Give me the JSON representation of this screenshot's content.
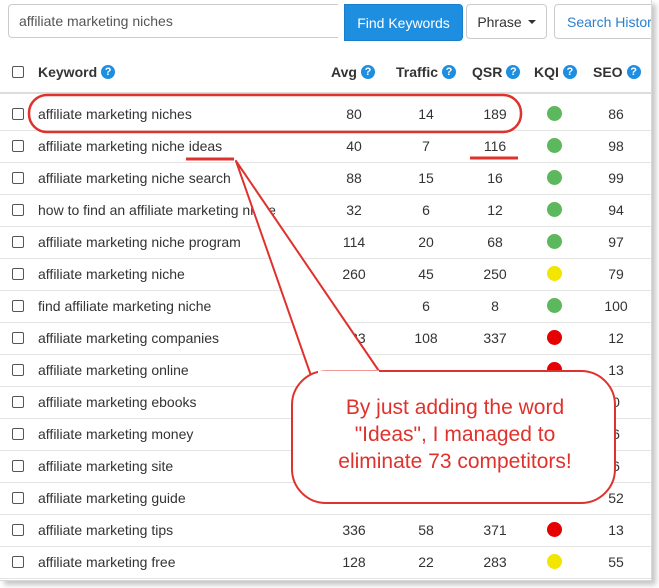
{
  "search": {
    "value": "affiliate marketing niches",
    "find_label": "Find Keywords",
    "phrase_label": "Phrase",
    "history_label": "Search History"
  },
  "headers": {
    "keyword": "Keyword",
    "avg": "Avg",
    "traffic": "Traffic",
    "qsr": "QSR",
    "kqi": "KQI",
    "seo": "SEO"
  },
  "colors": {
    "accent": "#1e8ee0",
    "annotation": "#e0322c",
    "kqi_green": "#5cb85c",
    "kqi_yellow": "#f2e600",
    "kqi_red": "#e60000"
  },
  "rows": [
    {
      "keyword": "affiliate marketing niches",
      "avg": "80",
      "traffic": "14",
      "qsr": "189",
      "kqi": "green",
      "seo": "86"
    },
    {
      "keyword": "affiliate marketing niche ideas",
      "avg": "40",
      "traffic": "7",
      "qsr": "116",
      "kqi": "green",
      "seo": "98"
    },
    {
      "keyword": "affiliate marketing niche search",
      "avg": "88",
      "traffic": "15",
      "qsr": "16",
      "kqi": "green",
      "seo": "99"
    },
    {
      "keyword": "how to find an affiliate marketing niche",
      "avg": "32",
      "traffic": "6",
      "qsr": "12",
      "kqi": "green",
      "seo": "94"
    },
    {
      "keyword": "affiliate marketing niche program",
      "avg": "114",
      "traffic": "20",
      "qsr": "68",
      "kqi": "green",
      "seo": "97"
    },
    {
      "keyword": "affiliate marketing niche",
      "avg": "260",
      "traffic": "45",
      "qsr": "250",
      "kqi": "yellow",
      "seo": "79"
    },
    {
      "keyword": "find affiliate marketing niche",
      "avg": "",
      "traffic": "6",
      "qsr": "8",
      "kqi": "green",
      "seo": "100"
    },
    {
      "keyword": "affiliate marketing companies",
      "avg": "633",
      "traffic": "108",
      "qsr": "337",
      "kqi": "red",
      "seo": "12"
    },
    {
      "keyword": "affiliate marketing online",
      "avg": "",
      "traffic": "",
      "qsr": "",
      "kqi": "red",
      "seo": "13"
    },
    {
      "keyword": "affiliate marketing ebooks",
      "avg": "",
      "traffic": "",
      "qsr": "",
      "kqi": "",
      "seo": "0"
    },
    {
      "keyword": "affiliate marketing money",
      "avg": "",
      "traffic": "",
      "qsr": "",
      "kqi": "",
      "seo": "6"
    },
    {
      "keyword": "affiliate marketing site",
      "avg": "",
      "traffic": "",
      "qsr": "",
      "kqi": "",
      "seo": "6"
    },
    {
      "keyword": "affiliate marketing guide",
      "avg": "",
      "traffic": "",
      "qsr": "",
      "kqi": "",
      "seo": "52"
    },
    {
      "keyword": "affiliate marketing tips",
      "avg": "336",
      "traffic": "58",
      "qsr": "371",
      "kqi": "red",
      "seo": "13"
    },
    {
      "keyword": "affiliate marketing free",
      "avg": "128",
      "traffic": "22",
      "qsr": "283",
      "kqi": "yellow",
      "seo": "55"
    }
  ],
  "annotation": {
    "line1": "By just adding the word",
    "line2": "\"Ideas\", I managed to",
    "line3": "eliminate 73 competitors!"
  }
}
